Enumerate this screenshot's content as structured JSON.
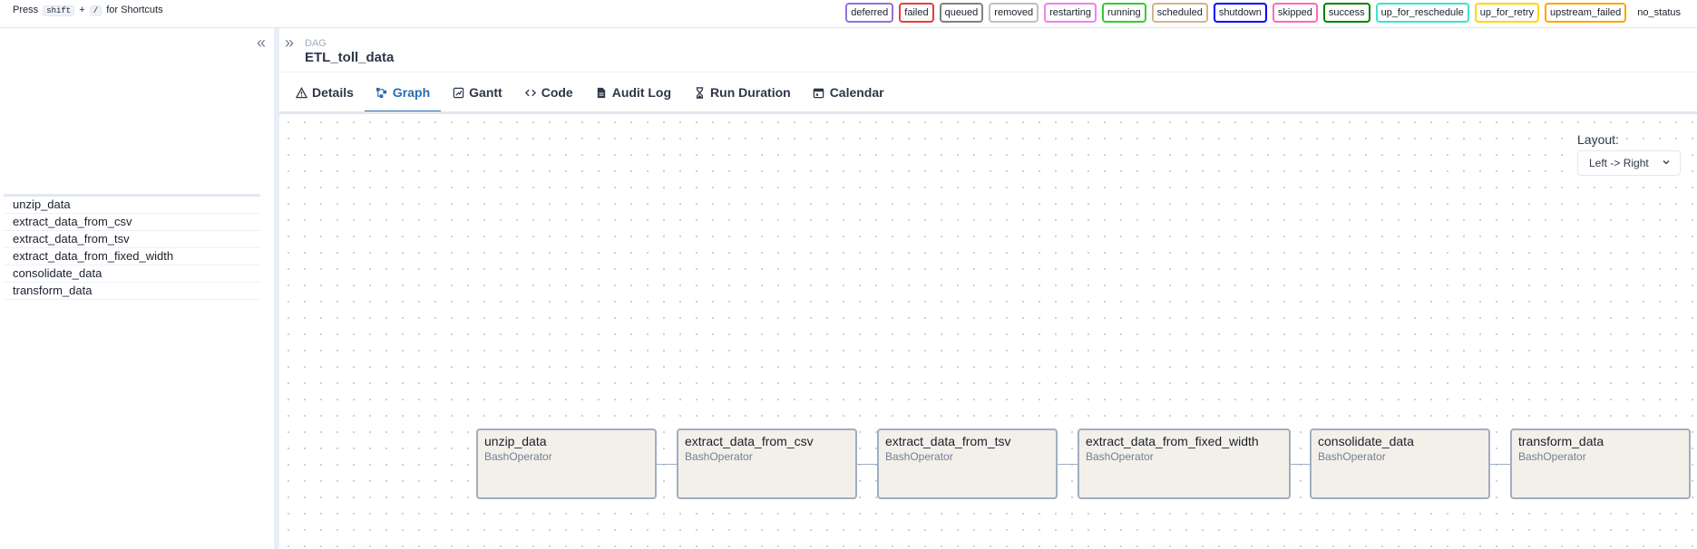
{
  "shortcut": {
    "press": "Press",
    "key1": "shift",
    "plus": "+",
    "key2": "/",
    "suffix": "for Shortcuts"
  },
  "legend": [
    {
      "label": "deferred",
      "color": "#9370db"
    },
    {
      "label": "failed",
      "color": "#e53e3e"
    },
    {
      "label": "queued",
      "color": "#808080"
    },
    {
      "label": "removed",
      "color": "#c0c0c0"
    },
    {
      "label": "restarting",
      "color": "#ee82ee"
    },
    {
      "label": "running",
      "color": "#32cd32"
    },
    {
      "label": "scheduled",
      "color": "#d2b48c"
    },
    {
      "label": "shutdown",
      "color": "#0000ff"
    },
    {
      "label": "skipped",
      "color": "#ff69b4"
    },
    {
      "label": "success",
      "color": "#008000"
    },
    {
      "label": "up_for_reschedule",
      "color": "#40e0d0"
    },
    {
      "label": "up_for_retry",
      "color": "#ffd700"
    },
    {
      "label": "upstream_failed",
      "color": "#ffa500"
    },
    {
      "label": "no_status",
      "color": ""
    }
  ],
  "dag": {
    "label": "DAG",
    "name": "ETL_toll_data"
  },
  "tabs": [
    {
      "label": "Details",
      "icon": "warning-icon"
    },
    {
      "label": "Graph",
      "icon": "graph-icon"
    },
    {
      "label": "Gantt",
      "icon": "gantt-icon"
    },
    {
      "label": "Code",
      "icon": "code-icon"
    },
    {
      "label": "Audit Log",
      "icon": "document-icon"
    },
    {
      "label": "Run Duration",
      "icon": "hourglass-icon"
    },
    {
      "label": "Calendar",
      "icon": "calendar-icon"
    }
  ],
  "active_tab": "Graph",
  "tasks": [
    "unzip_data",
    "extract_data_from_csv",
    "extract_data_from_tsv",
    "extract_data_from_fixed_width",
    "consolidate_data",
    "transform_data"
  ],
  "layout": {
    "label": "Layout:",
    "value": "Left -> Right"
  },
  "graph_nodes": [
    {
      "id": "unzip_data",
      "operator": "BashOperator"
    },
    {
      "id": "extract_data_from_csv",
      "operator": "BashOperator"
    },
    {
      "id": "extract_data_from_tsv",
      "operator": "BashOperator"
    },
    {
      "id": "extract_data_from_fixed_width",
      "operator": "BashOperator"
    },
    {
      "id": "consolidate_data",
      "operator": "BashOperator"
    },
    {
      "id": "transform_data",
      "operator": "BashOperator"
    }
  ],
  "colors": {
    "accent": "#2b6cb0",
    "node_fill": "#f3f0ea",
    "node_border": "#a0aec0"
  }
}
